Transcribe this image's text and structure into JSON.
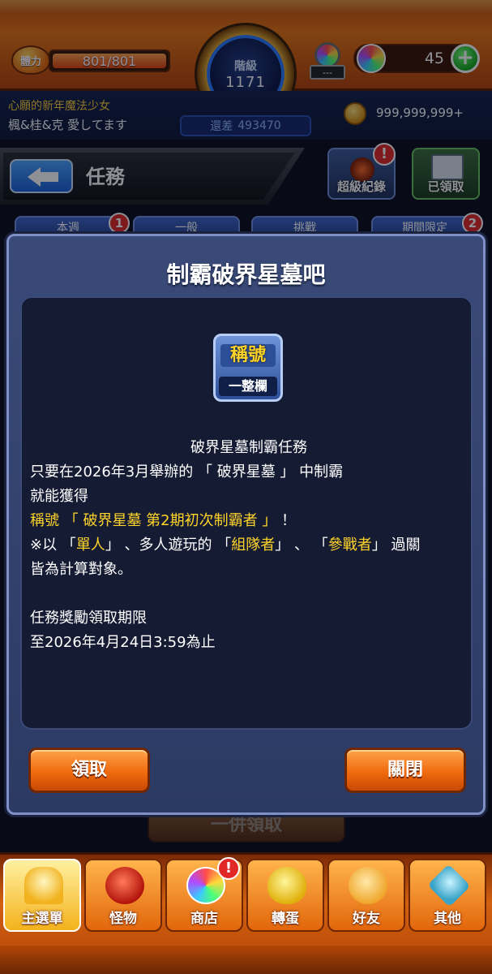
{
  "header": {
    "stamina_label": "體力",
    "stamina_value": "801/801",
    "stamina_fraction": 1.0,
    "rank_label": "階級",
    "rank_value": "1171",
    "gem_stand_text": "---",
    "orb_count": "45",
    "add_orb_symbol": "+",
    "player_title": "心願的新年魔法少女",
    "player_name": "楓&桂&克 愛してます",
    "rank_remaining_label": "還差",
    "rank_remaining_value": "493470",
    "gold_value": "999,999,999+"
  },
  "mission_bar": {
    "title": "任務",
    "record_label": "超級紀錄",
    "record_badge": "!",
    "claimed_label": "已領取"
  },
  "background_tabs": [
    {
      "label": "本週",
      "badge": "1"
    },
    {
      "label": "一般",
      "badge": ""
    },
    {
      "label": "挑戰",
      "badge": ""
    },
    {
      "label": "期間限定",
      "badge": "2"
    }
  ],
  "background_claim_all": "一併領取",
  "dialog": {
    "title": "制霸破界星墓吧",
    "reward": {
      "top_text": "稱號",
      "bottom_text": "一整欄"
    },
    "lines": {
      "l1": "破界星墓制霸任務",
      "l2": "只要在2026年3月舉辦的 「 破界星墓 」 中制霸",
      "l3": "就能獲得",
      "l4_hl": "稱號 「 破界星墓 第2期初次制霸者 」",
      "l4_tail": " ！",
      "l5_a": "※以 「",
      "l5_b": "單人",
      "l5_c": "」 、多人遊玩的 「",
      "l5_d": "組隊者",
      "l5_e": "」 、 「",
      "l5_f": "參戰者",
      "l5_g": "」 過關",
      "l6": "皆為計算對象。",
      "l7": "任務獎勵領取期限",
      "l8": "至2026年4月24日3:59為止"
    },
    "claim_button": "領取",
    "close_button": "關閉"
  },
  "bottom_nav": [
    {
      "label": "主選單",
      "icon": "home-icon",
      "active": true,
      "badge": ""
    },
    {
      "label": "怪物",
      "icon": "monster-icon",
      "active": false,
      "badge": ""
    },
    {
      "label": "商店",
      "icon": "orb-shop-icon",
      "active": false,
      "badge": "!"
    },
    {
      "label": "轉蛋",
      "icon": "gacha-egg-icon",
      "active": false,
      "badge": ""
    },
    {
      "label": "好友",
      "icon": "friends-icon",
      "active": false,
      "badge": ""
    },
    {
      "label": "其他",
      "icon": "other-icon",
      "active": false,
      "badge": ""
    }
  ],
  "colors": {
    "accent_orange": "#f06a0e",
    "highlight_yellow": "#ffd42a",
    "dialog_bg": "#2b3a63",
    "content_bg": "#151b33"
  }
}
